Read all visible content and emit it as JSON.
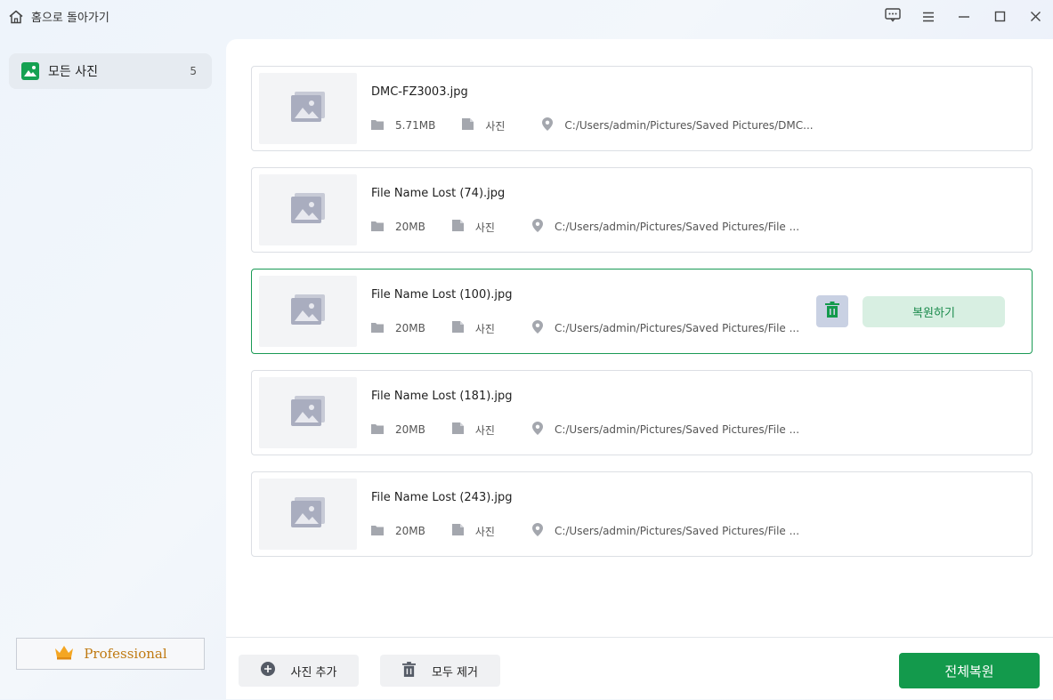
{
  "titlebar": {
    "back_label": "홈으로 돌아가기"
  },
  "sidebar": {
    "item": {
      "label": "모든 사진",
      "count": "5",
      "icon": "photo-icon"
    },
    "pro_label": "Professional",
    "pro_icon": "crown-icon"
  },
  "files": [
    {
      "name": "DMC-FZ3003.jpg",
      "size": "5.71MB",
      "type": "사진",
      "path": "C:/Users/admin/Pictures/Saved Pictures/DMC..."
    },
    {
      "name": "File Name Lost (74).jpg",
      "size": "20MB",
      "type": "사진",
      "path": "C:/Users/admin/Pictures/Saved Pictures/File ..."
    },
    {
      "name": "File Name Lost (100).jpg",
      "size": "20MB",
      "type": "사진",
      "path": "C:/Users/admin/Pictures/Saved Pictures/File ..."
    },
    {
      "name": "File Name Lost (181).jpg",
      "size": "20MB",
      "type": "사진",
      "path": "C:/Users/admin/Pictures/Saved Pictures/File ..."
    },
    {
      "name": "File Name Lost (243).jpg",
      "size": "20MB",
      "type": "사진",
      "path": "C:/Users/admin/Pictures/Saved Pictures/File ..."
    }
  ],
  "row_actions": {
    "recover_label": "복원하기"
  },
  "footer": {
    "add_label": "사진 추가",
    "clear_label": "모두 제거",
    "restore_all_label": "전체복원"
  },
  "colors": {
    "accent": "#139a4c",
    "selected_border": "#1a9a55",
    "recover_bg": "#d8efe2"
  }
}
